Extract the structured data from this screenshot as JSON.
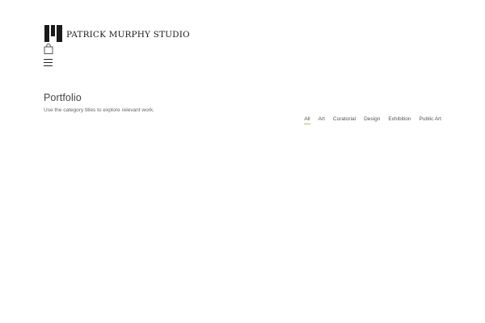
{
  "brand": {
    "name": "PATRICK MURPHY STUDIO"
  },
  "header": {
    "icons": [
      "bag-icon",
      "hamburger-menu-icon"
    ]
  },
  "portfolio": {
    "title": "Portfolio",
    "subtitle": "Use the category titles to explore relevant work.",
    "filters": [
      {
        "label": "All",
        "active": true
      },
      {
        "label": "Art",
        "active": false
      },
      {
        "label": "Curatorial",
        "active": false
      },
      {
        "label": "Design",
        "active": false
      },
      {
        "label": "Exhibition",
        "active": false
      },
      {
        "label": "Public Art",
        "active": false
      }
    ]
  },
  "colors": {
    "accent": "#c9b458",
    "text": "#333333",
    "background": "#ffffff"
  }
}
